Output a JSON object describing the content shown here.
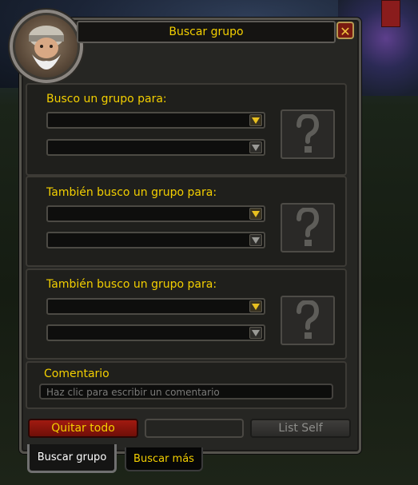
{
  "window": {
    "title": "Buscar grupo",
    "close_symbol": "✕"
  },
  "sections": [
    {
      "title": "Busco un grupo para:"
    },
    {
      "title": "También busco un grupo para:"
    },
    {
      "title": "También busco un grupo para:"
    }
  ],
  "help_icon": "question-mark-icon",
  "comment": {
    "label": "Comentario",
    "placeholder": "Haz clic para escribir un comentario"
  },
  "buttons": {
    "clear_all": "Quitar todo",
    "list_self": "List Self"
  },
  "tabs": [
    {
      "label": "Buscar grupo",
      "active": true
    },
    {
      "label": "Buscar más",
      "active": false
    }
  ],
  "colors": {
    "gold_text": "#f3cf00",
    "clear_button": "#a11a10",
    "frame": "#262623"
  }
}
